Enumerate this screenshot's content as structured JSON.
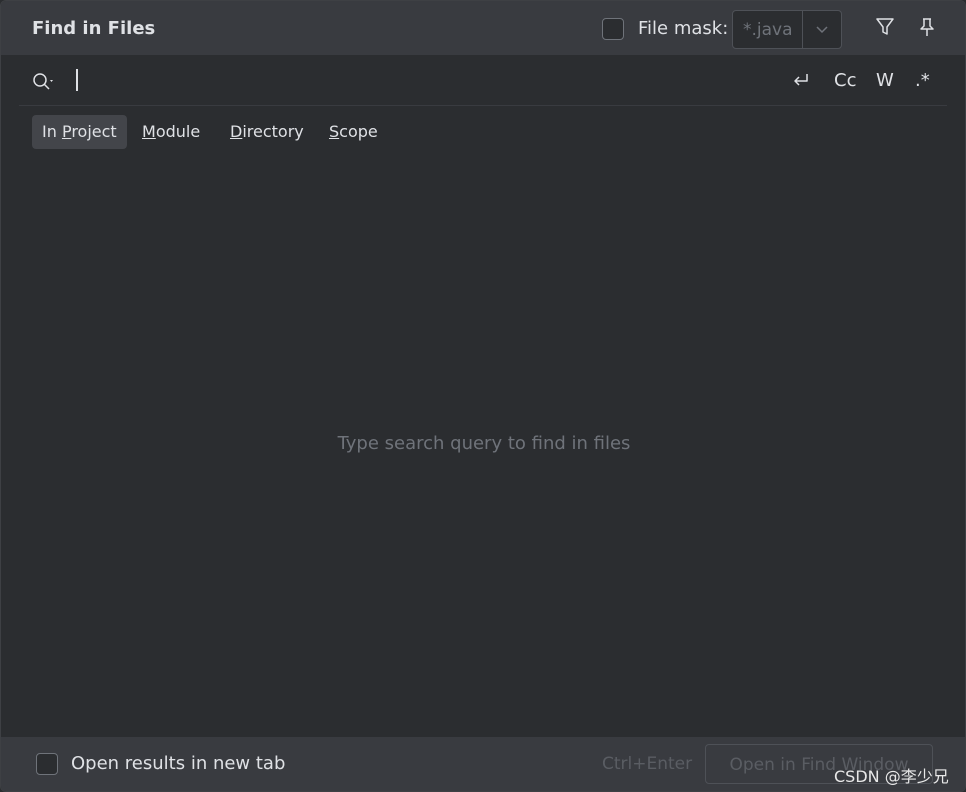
{
  "header": {
    "title": "Find in Files",
    "file_mask_label": "File mask:",
    "file_mask_value": "*.java",
    "file_mask_checked": false
  },
  "icons": {
    "filter": "filter-icon",
    "pin": "pin-icon",
    "search": "search-icon",
    "dropdown": "chevron-down-icon"
  },
  "search": {
    "query": "",
    "options": {
      "newline": "↩",
      "match_case": "Cc",
      "words": "W",
      "regex": ".*"
    }
  },
  "scopes": {
    "in_project": {
      "prefix": "In ",
      "mnemonic": "P",
      "rest": "roject",
      "active": true
    },
    "module": {
      "prefix": "",
      "mnemonic": "M",
      "rest": "odule",
      "active": false
    },
    "directory": {
      "prefix": "",
      "mnemonic": "D",
      "rest": "irectory",
      "active": false
    },
    "scope": {
      "prefix": "",
      "mnemonic": "S",
      "rest": "cope",
      "active": false
    }
  },
  "results": {
    "empty_text": "Type search query to find in files"
  },
  "footer": {
    "new_tab_label": "Open results in new tab",
    "shortcut": "Ctrl+Enter",
    "open_button": "Open in Find Window"
  },
  "watermark": "CSDN @李少兄",
  "colors": {
    "background": "#2b2d30",
    "header": "#393b40",
    "text": "#dfe1e5",
    "muted": "#6f737a",
    "active_tab": "#43454a"
  }
}
